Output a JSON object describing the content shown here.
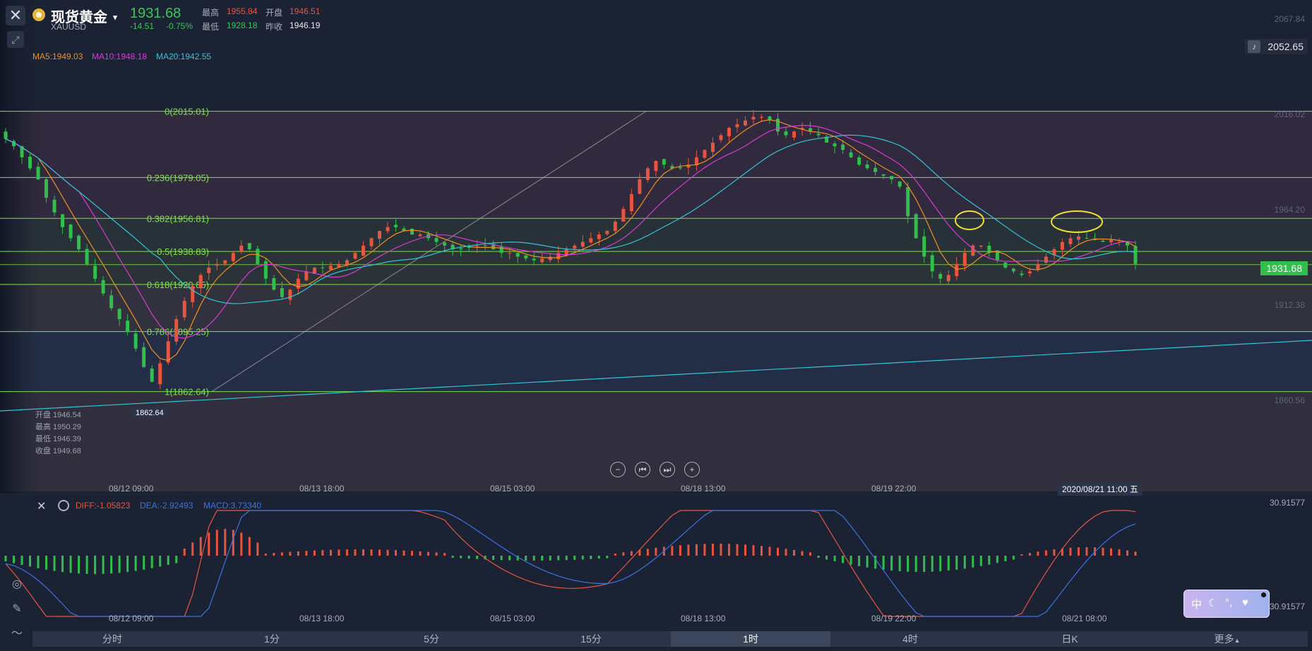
{
  "header": {
    "title": "现货黄金",
    "symbol": "XAUUSD",
    "price": "1931.68",
    "change": "-14.51",
    "change_pct": "-0.75%",
    "high_label": "最高",
    "high": "1955.84",
    "open_label": "开盘",
    "open": "1946.51",
    "low_label": "最低",
    "low": "1928.18",
    "prev_close_label": "昨收",
    "prev_close": "1946.19"
  },
  "ma": {
    "ma5": "MA5:1949.03",
    "ma10": "MA10:1948.18",
    "ma20": "MA20:1942.55"
  },
  "right_axis": {
    "labels": [
      "2067.84",
      "2016.02",
      "1964.20",
      "1912.38",
      "1860.56"
    ],
    "alert_price": "2052.65",
    "current_price": "1931.68"
  },
  "fib_levels": [
    {
      "label": "0(2015.01)",
      "value": 2015.01
    },
    {
      "label": "0.236(1979.05)",
      "value": 1979.05
    },
    {
      "label": "0.382(1956.81)",
      "value": 1956.81
    },
    {
      "label": "0.5(1938.83)",
      "value": 1938.83
    },
    {
      "label": "0.618(1920.85)",
      "value": 1920.85
    },
    {
      "label": "0.786(1895.25)",
      "value": 1895.25
    },
    {
      "label": "1(1862.64)",
      "value": 1862.64
    }
  ],
  "low_marker": "1862.64",
  "ohlc_box": {
    "open": "开盘 1946.54",
    "high": "最高 1950.29",
    "low": "最低 1946.39",
    "close": "收盘 1949.68"
  },
  "x_axis_main": [
    "08/12 09:00",
    "08/13 18:00",
    "08/15 03:00",
    "08/18 13:00",
    "08/19 22:00"
  ],
  "crosshair_time": "2020/08/21 11:00 五",
  "macd": {
    "diff": "DIFF:-1.05823",
    "dea": "DEA:-2.92493",
    "macd": "MACD:3.73340",
    "top_value": "30.91577",
    "bottom_value": "30.91577",
    "x_axis": [
      "08/12 09:00",
      "08/13 18:00",
      "08/15 03:00",
      "08/18 13:00",
      "08/19 22:00",
      "08/21 08:00"
    ]
  },
  "tabs": [
    "分时",
    "1分",
    "5分",
    "15分",
    "1时",
    "4时",
    "日K",
    "更多"
  ],
  "active_tab": "1时",
  "colors": {
    "up": "#e8553f",
    "down": "#2fbf4a",
    "ma5": "#f0901e",
    "ma10": "#d63ad6",
    "ma20": "#2fc6d6",
    "fib": "#7fe04a"
  },
  "chart_data": {
    "type": "candlestick",
    "price_range": [
      1845,
      2075
    ],
    "close_series": [
      2000,
      1996,
      1990,
      1984,
      1978,
      1968,
      1960,
      1952,
      1946,
      1940,
      1932,
      1924,
      1916,
      1908,
      1902,
      1895,
      1886,
      1876,
      1868,
      1878,
      1890,
      1902,
      1912,
      1920,
      1926,
      1930,
      1932,
      1934,
      1938,
      1942,
      1940,
      1932,
      1924,
      1918,
      1914,
      1918,
      1924,
      1928,
      1930,
      1930,
      1931,
      1932,
      1934,
      1938,
      1942,
      1946,
      1950,
      1952,
      1952,
      1950,
      1948,
      1948,
      1946,
      1944,
      1942,
      1940,
      1940,
      1941,
      1942,
      1942,
      1940,
      1938,
      1938,
      1936,
      1935,
      1934,
      1935,
      1936,
      1938,
      1940,
      1942,
      1944,
      1946,
      1948,
      1950,
      1955,
      1962,
      1970,
      1978,
      1984,
      1988,
      1986,
      1984,
      1984,
      1986,
      1990,
      1994,
      1998,
      2002,
      2006,
      2008,
      2010,
      2012,
      2012,
      2010,
      2004,
      2002,
      2004,
      2006,
      2004,
      2002,
      1998,
      1996,
      1994,
      1990,
      1986,
      1984,
      1982,
      1980,
      1978,
      1974,
      1958,
      1946,
      1936,
      1928,
      1924,
      1926,
      1932,
      1938,
      1942,
      1942,
      1938,
      1934,
      1930,
      1928,
      1926,
      1928,
      1932,
      1936,
      1940,
      1944,
      1946,
      1947,
      1946,
      1945,
      1944,
      1945,
      1944,
      1942,
      1932
    ]
  }
}
